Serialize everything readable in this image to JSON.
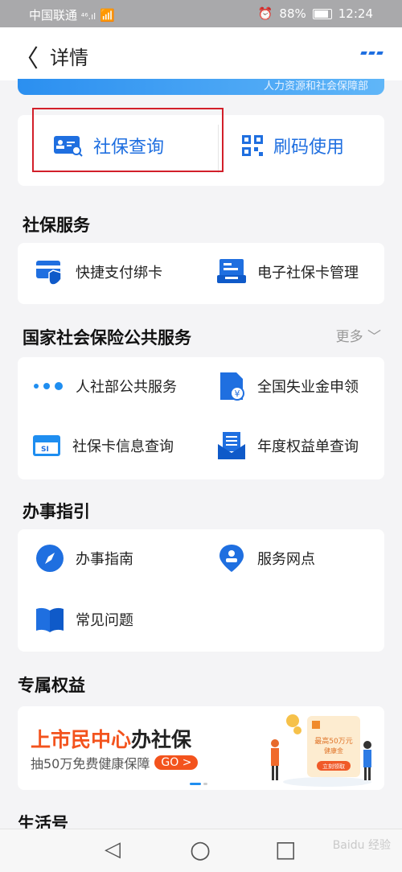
{
  "status": {
    "carrier": "中国联通",
    "signal": "⁴⁶.ıl",
    "battery": "88%",
    "time": "12:24"
  },
  "header": {
    "back_icon": "chevron-left-icon",
    "title": "详情"
  },
  "banner": {
    "org": "人力资源和社会保障部"
  },
  "quick": {
    "query_label": "社保查询",
    "scan_label": "刷码使用"
  },
  "social_service": {
    "title": "社保服务",
    "items": [
      {
        "label": "快捷支付绑卡"
      },
      {
        "label": "电子社保卡管理"
      }
    ]
  },
  "national": {
    "title": "国家社会保险公共服务",
    "more": "更多",
    "items": [
      {
        "label": "人社部公共服务"
      },
      {
        "label": "全国失业金申领"
      },
      {
        "label": "社保卡信息查询"
      },
      {
        "label": "年度权益单查询"
      }
    ]
  },
  "guide": {
    "title": "办事指引",
    "items": [
      {
        "label": "办事指南"
      },
      {
        "label": "服务网点"
      },
      {
        "label": "常见问题"
      }
    ]
  },
  "benefits": {
    "title": "专属权益",
    "promo_orange": "上市民中心",
    "promo_dark": "办社保",
    "promo_sub": "抽50万免费健康保障",
    "promo_go": "GO >",
    "promo_card": "最高50万元",
    "promo_card2": "健康金",
    "promo_btn": "立刻领取"
  },
  "life": {
    "title": "生活号"
  },
  "nav": {
    "back": "◁",
    "home": "○",
    "recent": "□"
  },
  "watermark": "Baidu 经验"
}
